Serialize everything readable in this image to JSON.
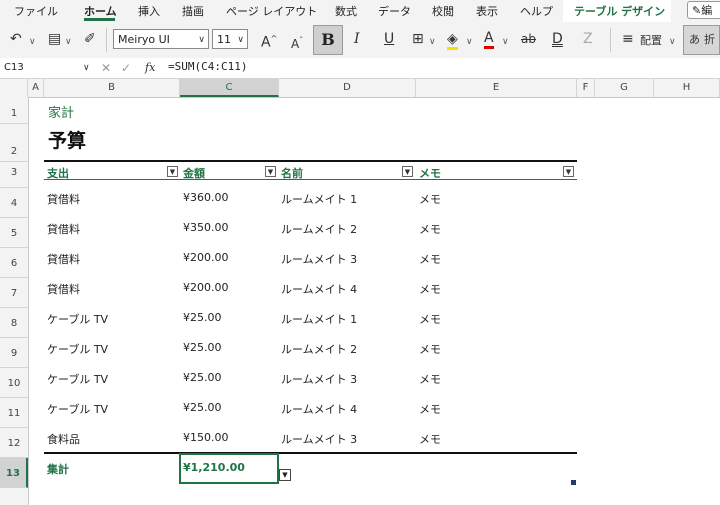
{
  "ribbon": {
    "tabs": [
      "ファイル",
      "ホーム",
      "挿入",
      "描画",
      "ページ レイアウト",
      "数式",
      "データ",
      "校閲",
      "表示",
      "ヘルプ",
      "テーブル デザイン"
    ],
    "active_tab": "ホーム",
    "edit_label": "編"
  },
  "toolbar": {
    "font_name": "Meiryo UI",
    "font_size": "11",
    "bold_label": "B",
    "italic_label": "I",
    "underline_label": "U",
    "strike_label": "ab",
    "double_underline_label": "D",
    "align_label": "配置",
    "wrap_label": "折"
  },
  "formula_bar": {
    "name_box": "C13",
    "fx_label": "fx",
    "formula": "=SUM(C4:C11)"
  },
  "grid": {
    "columns": [
      "A",
      "B",
      "C",
      "D",
      "E",
      "F",
      "G",
      "H"
    ],
    "rows": [
      "1",
      "2",
      "3",
      "4",
      "5",
      "6",
      "7",
      "8",
      "9",
      "10",
      "11",
      "12",
      "13"
    ],
    "selected_column": "C",
    "selected_row": "13"
  },
  "sheet": {
    "title_small": "家計",
    "title_big": "予算",
    "headers": [
      "支出",
      "金額",
      "名前",
      "メモ"
    ],
    "rows": [
      [
        "貸借料",
        "¥360.00",
        "ルームメイト 1",
        "メモ"
      ],
      [
        "貸借料",
        "¥350.00",
        "ルームメイト 2",
        "メモ"
      ],
      [
        "貸借料",
        "¥200.00",
        "ルームメイト 3",
        "メモ"
      ],
      [
        "貸借料",
        "¥200.00",
        "ルームメイト 4",
        "メモ"
      ],
      [
        "ケーブル TV",
        "¥25.00",
        "ルームメイト 1",
        "メモ"
      ],
      [
        "ケーブル TV",
        "¥25.00",
        "ルームメイト 2",
        "メモ"
      ],
      [
        "ケーブル TV",
        "¥25.00",
        "ルームメイト 3",
        "メモ"
      ],
      [
        "ケーブル TV",
        "¥25.00",
        "ルームメイト 4",
        "メモ"
      ],
      [
        "食料品",
        "¥150.00",
        "ルームメイト 3",
        "メモ"
      ]
    ],
    "total_label": "集計",
    "total_value": "¥1,210.00"
  },
  "colors": {
    "accent": "#217346",
    "ribbon_bg": "#f3f3f3",
    "table_border": "#111111"
  }
}
